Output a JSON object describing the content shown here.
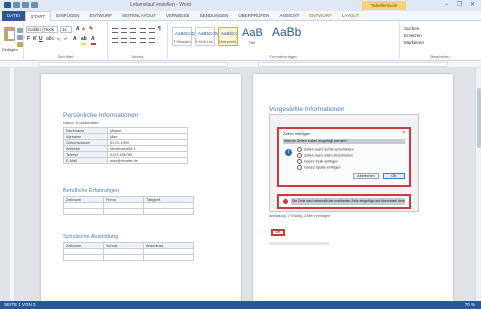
{
  "titlebar": {
    "document_title": "Lebenslauf erstellen - Word",
    "context_tab": "Tabellentools",
    "minimize": "−",
    "restore": "❐",
    "close": "✕"
  },
  "ribbon_tabs": [
    "DATEI",
    "START",
    "EINFÜGEN",
    "ENTWURF",
    "SEITENLAYOUT",
    "VERWEISE",
    "SENDUNGEN",
    "ÜBERPRÜFEN",
    "ANSICHT",
    "ENTWURF",
    "LAYOUT"
  ],
  "ribbon": {
    "paste_label": "Einfügen",
    "clipboard_group": "Zwischenablage",
    "font_name": "Calibri (Textk",
    "font_size": "11",
    "font_group": "Schriftart",
    "paragraph_group": "Absatz",
    "styles": [
      {
        "sample": "AaBbCcDc",
        "name": "¶ Standard"
      },
      {
        "sample": "AaBbCcDc",
        "name": "¶ Kein Lee..."
      },
      {
        "sample": "AaBbCc",
        "name": "Überschrift 1"
      }
    ],
    "title_style": {
      "sample": "AaB",
      "name": "Titel"
    },
    "styles_group": "Formatvorlagen",
    "edit_items": [
      "Suchen",
      "Ersetzen",
      "Markieren"
    ],
    "edit_group": "Bearbeiten"
  },
  "left_page": {
    "heading": "Persönliche Informationen",
    "subnote": "Name, Kontaktdaten",
    "rows": [
      [
        "Nachname",
        "Muster"
      ],
      [
        "Vorname",
        "Max"
      ],
      [
        "Geburtsdatum",
        "01.01.1990"
      ],
      [
        "Adresse",
        "Musterstraße 1"
      ],
      [
        "Telefon",
        "0123 456789"
      ],
      [
        "E-Mail",
        "max@muster.de"
      ]
    ],
    "section2_heading": "Berufliche Erfahrungen",
    "section2_headers": [
      "Zeitraum",
      "Firma",
      "Tätigkeit"
    ],
    "section3_heading": "Schulische Ausbildung",
    "section3_headers": [
      "Zeitraum",
      "Schule",
      "Abschluss"
    ]
  },
  "right_page": {
    "heading": "Vorgestellte Informationen",
    "dialog_title": "Zellen einfügen",
    "dialog_question": "Welche Zellen sollen eingefügt werden?",
    "radio_options": [
      "Zellen nach rechts verschieben",
      "Zellen nach unten verschieben",
      "Ganze Zeile einfügen",
      "Ganze Spalte einfügen"
    ],
    "cancel_label": "Abbrechen",
    "ok_label": "OK",
    "warning_text": "Die Zeile wird unterhalb der markierten Zelle eingefügt und übernimmt deren Format.",
    "caption": "Abbildung 1: Dialog „Zellen einfügen\"",
    "final_ok_label": "OK"
  },
  "status": {
    "page": "SEITE 1 VON 2",
    "zoom": "70 %"
  }
}
